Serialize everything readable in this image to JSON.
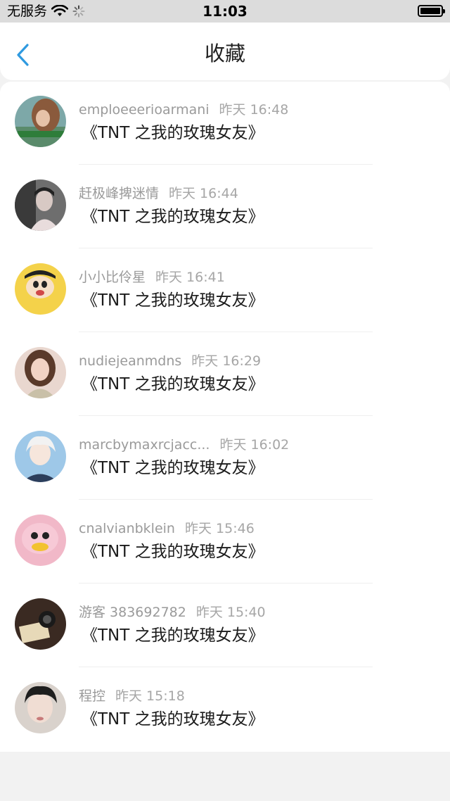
{
  "status_bar": {
    "carrier": "无服务",
    "time": "11:03"
  },
  "nav": {
    "title": "收藏"
  },
  "items": [
    {
      "user": "emploeeerioarmani",
      "time": "昨天 16:48",
      "title": "《TNT 之我的玫瑰女友》"
    },
    {
      "user": "赶极峰捭迷情",
      "time": "昨天 16:44",
      "title": "《TNT 之我的玫瑰女友》"
    },
    {
      "user": "小小比伶星",
      "time": "昨天 16:41",
      "title": "《TNT 之我的玫瑰女友》"
    },
    {
      "user": "nudiejeanmdns",
      "time": "昨天 16:29",
      "title": "《TNT 之我的玫瑰女友》"
    },
    {
      "user": "marcbymaxrcjacc...",
      "time": "昨天 16:02",
      "title": "《TNT 之我的玫瑰女友》"
    },
    {
      "user": "cnalvianbklein",
      "time": "昨天 15:46",
      "title": "《TNT 之我的玫瑰女友》"
    },
    {
      "user": "游客 383692782",
      "time": "昨天 15:40",
      "title": "《TNT 之我的玫瑰女友》"
    },
    {
      "user": "程控",
      "time": "昨天 15:18",
      "title": "《TNT 之我的玫瑰女友》"
    }
  ],
  "colors": {
    "accent": "#2f9ae0",
    "background": "#f2f2f2",
    "meta_text": "#9a9a9a",
    "title_text": "#1b1b1b"
  }
}
